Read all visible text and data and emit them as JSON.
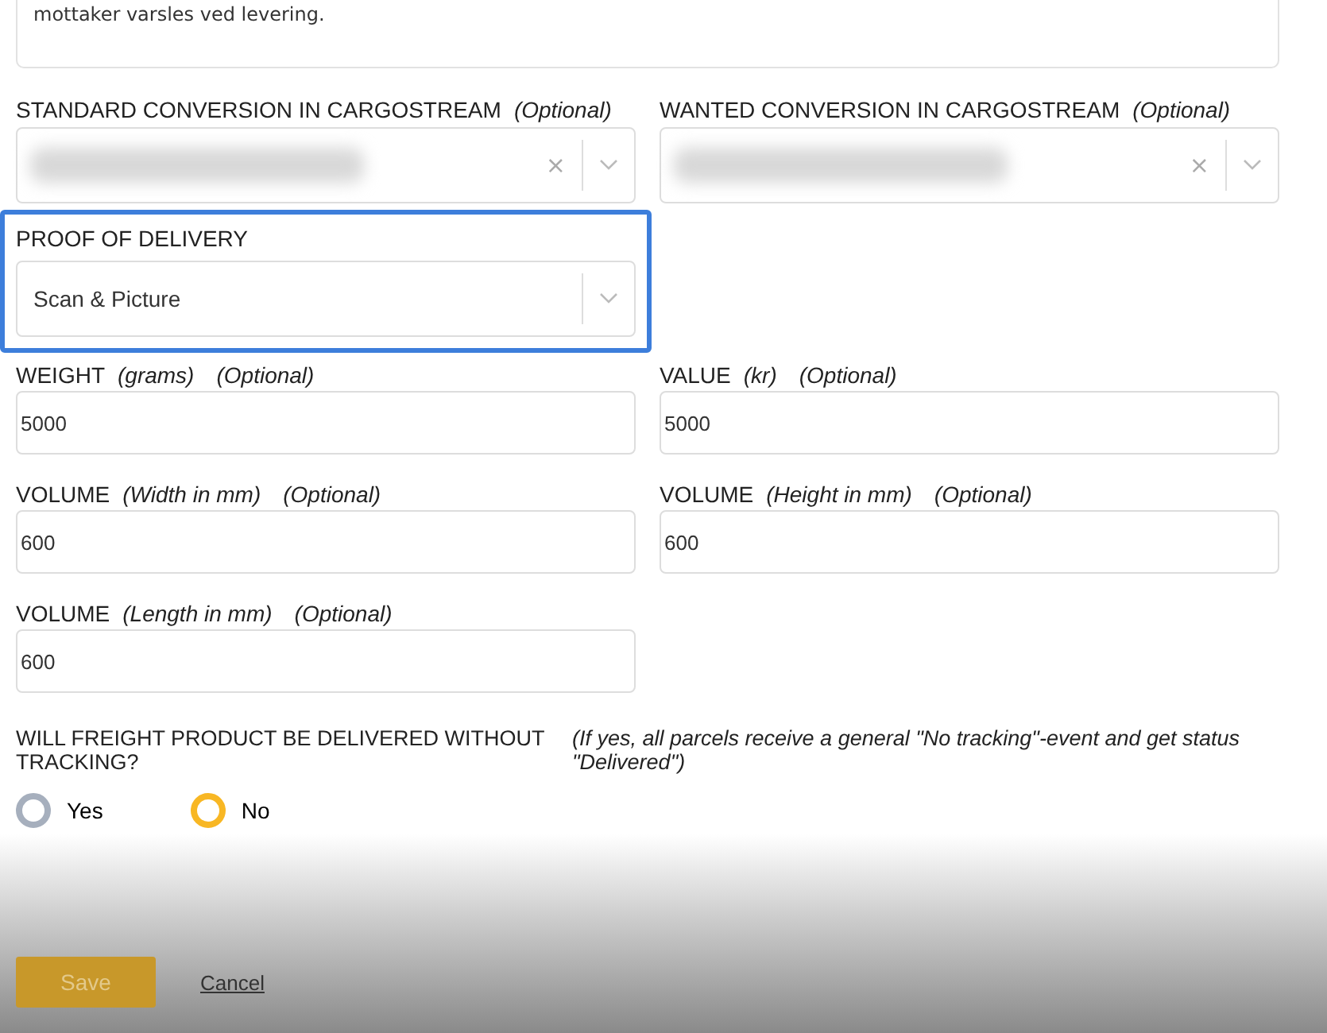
{
  "description_field": {
    "value": "mottaker varsles ved levering."
  },
  "conversion_selects": [
    {
      "label": "STANDARD CONVERSION IN CARGOSTREAM",
      "optional": "(Optional)",
      "clear": "×"
    },
    {
      "label": "WANTED CONVERSION IN CARGOSTREAM",
      "optional": "(Optional)",
      "clear": "×"
    }
  ],
  "proof_of_delivery": {
    "label": "PROOF OF DELIVERY",
    "value": "Scan & Picture",
    "focused": true
  },
  "measure_fields": [
    {
      "label": "WEIGHT",
      "unit": "(grams)",
      "optional": "(Optional)",
      "value": "5000"
    },
    {
      "label": "VALUE",
      "unit": "(kr)",
      "optional": "(Optional)",
      "value": "5000"
    },
    {
      "label": "VOLUME",
      "unit": "(Width in mm)",
      "optional": "(Optional)",
      "value": "600"
    },
    {
      "label": "VOLUME",
      "unit": "(Height in mm)",
      "optional": "(Optional)",
      "value": "600"
    },
    {
      "label": "VOLUME",
      "unit": "(Length in mm)",
      "optional": "(Optional)",
      "value": "600"
    }
  ],
  "tracking_question": {
    "label": "WILL FREIGHT PRODUCT BE DELIVERED WITHOUT TRACKING?",
    "hint": "(If yes, all parcels receive a general \"No tracking\"-event and get status \"Delivered\")",
    "options": [
      {
        "label": "Yes",
        "selected": false
      },
      {
        "label": "No",
        "selected": true
      }
    ]
  },
  "actions": {
    "save": "Save",
    "cancel": "Cancel"
  }
}
